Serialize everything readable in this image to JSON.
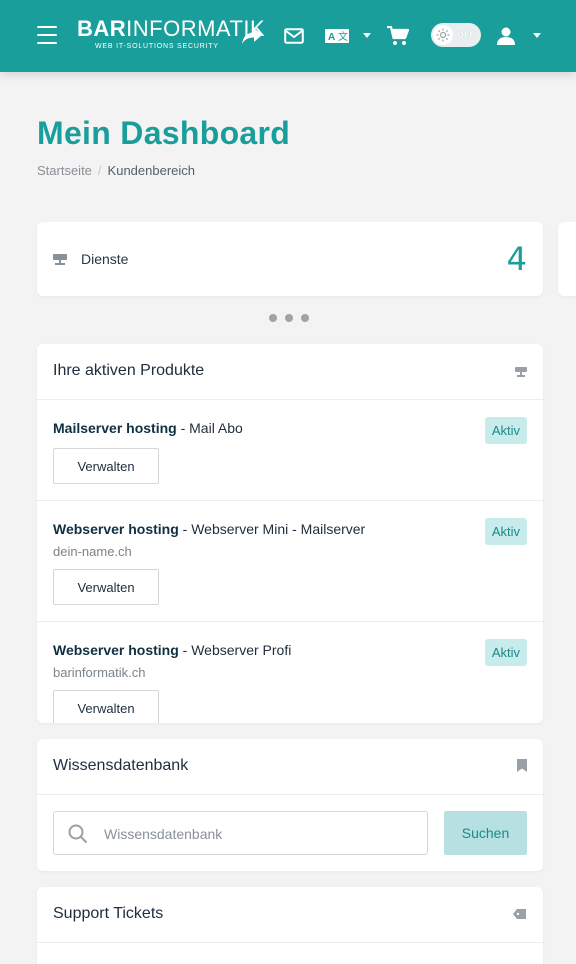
{
  "header": {
    "brand_bold": "BAR",
    "brand_rest": "INFORMATIK",
    "brand_tagline": "WEB   IT-SOLUTIONS   SECURITY",
    "toggle_label": "OFF",
    "accent_color": "#1a9e9b",
    "icons": [
      "menu-icon",
      "share-icon",
      "mail-icon",
      "translate-icon",
      "cart-icon",
      "brightness-icon",
      "user-icon"
    ]
  },
  "page": {
    "title": "Mein Dashboard",
    "breadcrumb": [
      "Startseite",
      "Kundenbereich"
    ]
  },
  "stats": {
    "label": "Dienste",
    "count": "4"
  },
  "products": {
    "title": "Ihre aktiven Produkte",
    "items": [
      {
        "type": "Mailserver hosting",
        "name": " - Mail Abo",
        "domain": "",
        "status": "Aktiv",
        "action": "Verwalten"
      },
      {
        "type": "Webserver hosting",
        "name": " - Webserver Mini - Mailserver",
        "domain": "dein-name.ch",
        "status": "Aktiv",
        "action": "Verwalten"
      },
      {
        "type": "Webserver hosting",
        "name": " - Webserver Profi",
        "domain": "barinformatik.ch",
        "status": "Aktiv",
        "action": "Verwalten"
      }
    ]
  },
  "knowledgebase": {
    "title": "Wissensdatenbank",
    "placeholder": "Wissensdatenbank",
    "button": "Suchen"
  },
  "tickets": {
    "title": "Support Tickets"
  }
}
